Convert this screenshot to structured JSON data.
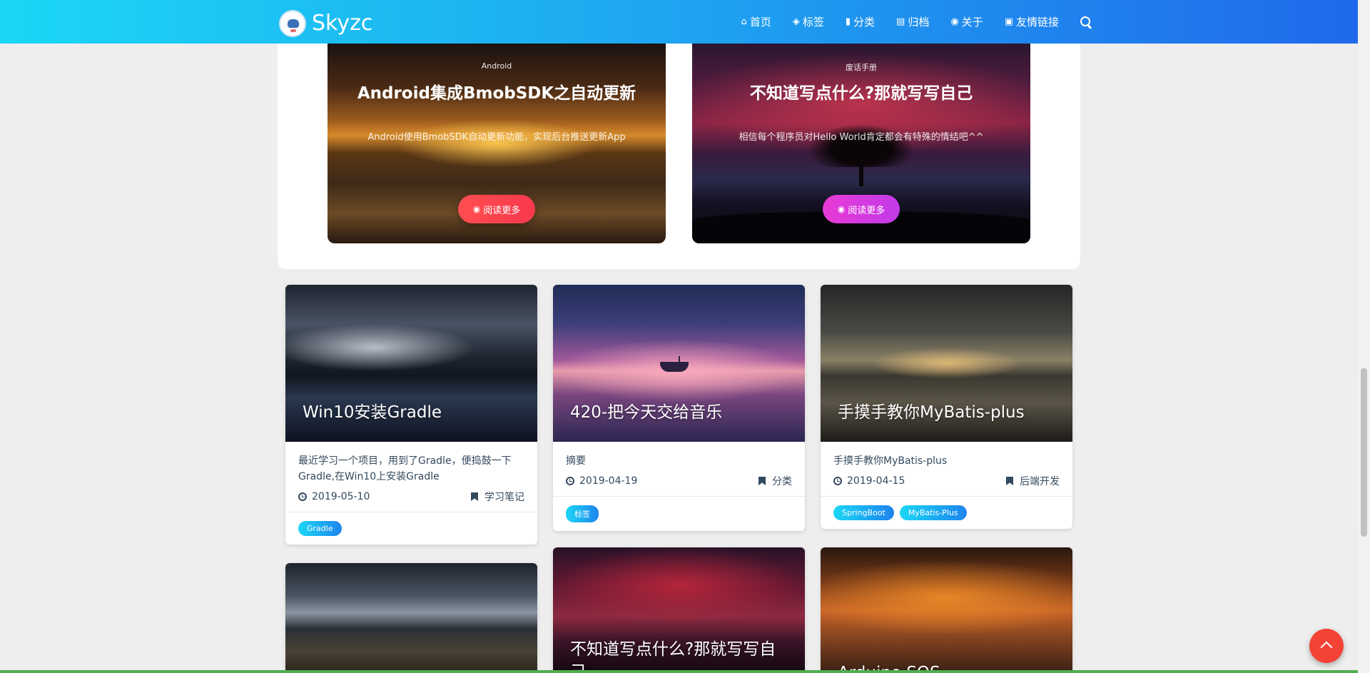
{
  "site": {
    "name": "Skyzc"
  },
  "nav": [
    {
      "label": "首页",
      "icon": "home-icon"
    },
    {
      "label": "标签",
      "icon": "tags-icon"
    },
    {
      "label": "分类",
      "icon": "bookmark-icon"
    },
    {
      "label": "归档",
      "icon": "archive-icon"
    },
    {
      "label": "关于",
      "icon": "user-circle-icon"
    },
    {
      "label": "友情链接",
      "icon": "address-book-icon"
    }
  ],
  "featured": [
    {
      "category": "Android",
      "title": "Android集成BmobSDK之自动更新",
      "description": "Android使用BmobSDK自动更新功能，实现后台推送更新App",
      "button": "阅读更多"
    },
    {
      "category": "废话手册",
      "title": "不知道写点什么?那就写写自己",
      "description": "相信每个程序员对Hello World肯定都会有特殊的情结吧^^",
      "button": "阅读更多"
    }
  ],
  "articles": [
    {
      "title": "Win10安装Gradle",
      "summary": "最近学习一个项目，用到了Gradle，便捣鼓一下Gradle,在Win10上安装Gradle",
      "date": "2019-05-10",
      "category": "学习笔记",
      "tags": [
        "Gradle"
      ]
    },
    {
      "title": "420-把今天交给音乐",
      "summary": "摘要",
      "date": "2019-04-19",
      "category": "分类",
      "tags": [
        "标签"
      ]
    },
    {
      "title": "手摸手教你MyBatis-plus",
      "summary": "手摸手教你MyBatis-plus",
      "date": "2019-04-15",
      "category": "后端开发",
      "tags": [
        "SpringBoot",
        "MyBatis-Plus"
      ]
    },
    {
      "title": ""
    },
    {
      "title": "不知道写点什么?那就写写自己"
    },
    {
      "title": "Arduino SOS"
    }
  ],
  "colors": {
    "header_start": "#1bd7f5",
    "header_end": "#2069ec",
    "back_to_top": "#f44336"
  }
}
